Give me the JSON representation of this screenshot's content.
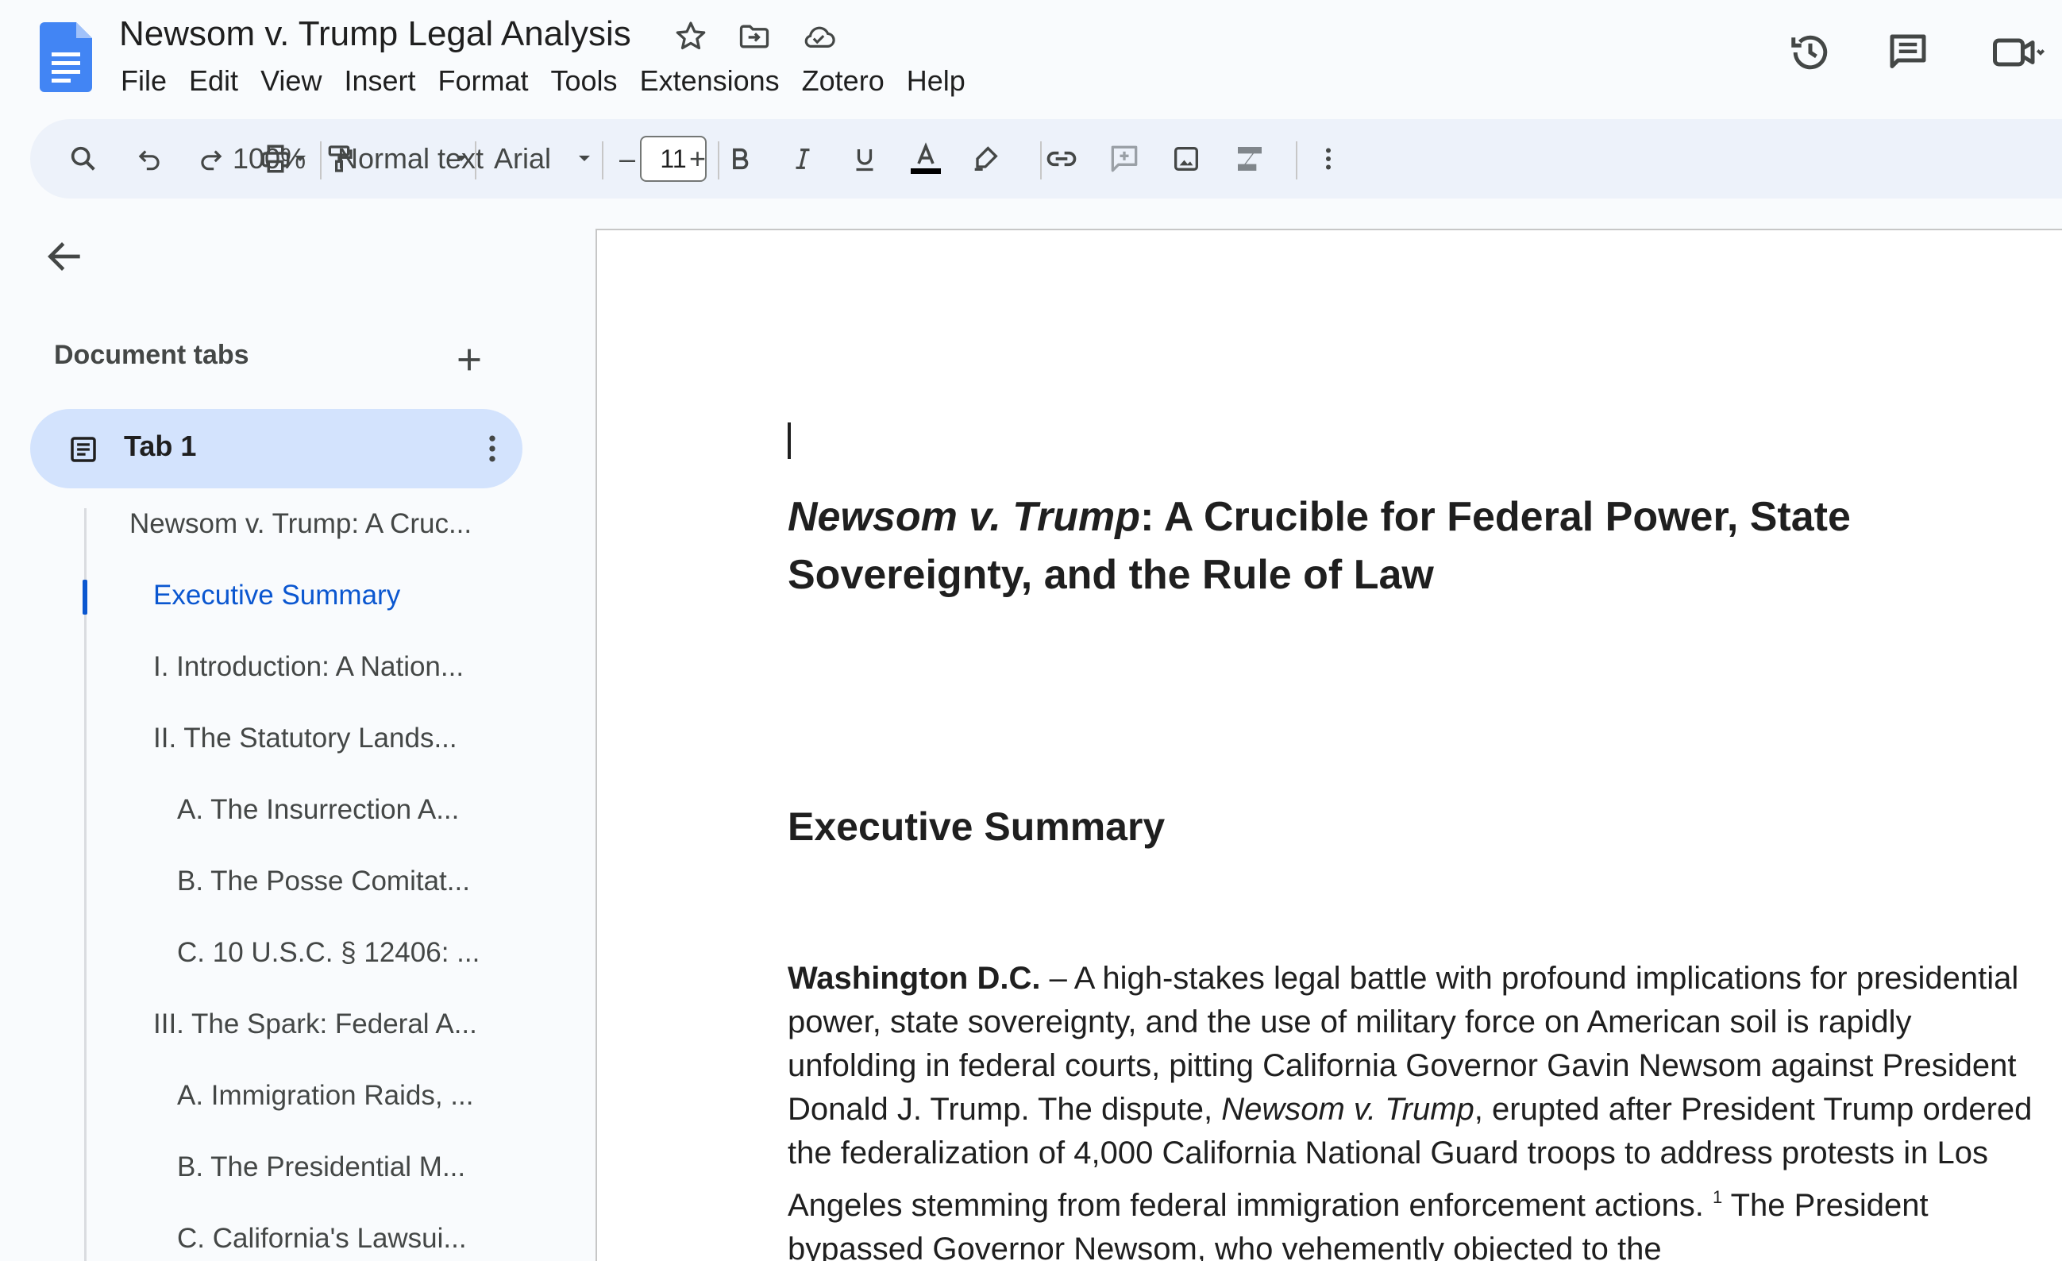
{
  "app": {
    "doc_title": "Newsom v. Trump Legal Analysis",
    "menu": [
      "File",
      "Edit",
      "View",
      "Insert",
      "Format",
      "Tools",
      "Extensions",
      "Zotero",
      "Help"
    ]
  },
  "toolbar": {
    "zoom": "100%",
    "style": "Normal text",
    "font": "Arial",
    "font_size": "11",
    "minus": "–",
    "plus": "+"
  },
  "sidebar": {
    "heading": "Document tabs",
    "tab_label": "Tab 1",
    "outline": [
      {
        "text": "Newsom v. Trump: A Cruc...",
        "level": 0
      },
      {
        "text": "Executive Summary",
        "level": 1,
        "active": true
      },
      {
        "text": "I. Introduction: A Nation...",
        "level": 1
      },
      {
        "text": "II. The Statutory Lands...",
        "level": 1
      },
      {
        "text": "A. The Insurrection A...",
        "level": 2
      },
      {
        "text": "B. The Posse Comitat...",
        "level": 2
      },
      {
        "text": "C. 10 U.S.C. § 12406: ...",
        "level": 2
      },
      {
        "text": "III. The Spark: Federal A...",
        "level": 1
      },
      {
        "text": "A. Immigration Raids, ...",
        "level": 2
      },
      {
        "text": "B. The Presidential M...",
        "level": 2
      },
      {
        "text": "C. California's Lawsui...",
        "level": 2
      }
    ]
  },
  "document": {
    "title_italic": "Newsom v. Trump",
    "title_rest": ": A Crucible for Federal Power, State Sovereignty, and the Rule of Law",
    "h2": "Executive Summary",
    "p_dateline": "Washington D.C.",
    "p_part1": " – A high-stakes legal battle with profound implications for presidential power, state sovereignty, and the use of military force on American soil is rapidly unfolding in federal courts, pitting California Governor Gavin Newsom against President Donald J. Trump. The dispute, ",
    "p_italic": "Newsom v. Trump",
    "p_part2": ", erupted after President Trump ordered the federalization of 4,000 California National Guard troops to address protests in Los Angeles stemming from federal immigration enforcement actions.",
    "p_footnote": "1",
    "p_part3": " The President bypassed Governor Newsom, who vehemently objected to the"
  },
  "colors": {
    "accent": "#0b57d0",
    "tab_bg": "#d3e3fd",
    "toolbar_bg": "#edf2fa",
    "docs_blue": "#4285f4"
  },
  "icons": [
    "docs-logo",
    "star-icon",
    "move-folder-icon",
    "cloud-saved-icon",
    "history-icon",
    "comments-icon",
    "video-call-icon",
    "search-icon",
    "undo-icon",
    "redo-icon",
    "print-icon",
    "paint-format-icon",
    "bold-icon",
    "italic-icon",
    "underline-icon",
    "text-color-icon",
    "highlight-icon",
    "link-icon",
    "add-comment-icon",
    "image-icon",
    "clear-format-icon",
    "more-vert-icon",
    "back-arrow-icon",
    "add-tab-icon",
    "document-tab-icon"
  ]
}
